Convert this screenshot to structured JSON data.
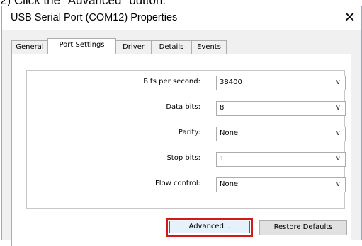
{
  "caption": "2) Click the \"Advanced\" button.",
  "window": {
    "title": "USB Serial Port (COM12) Properties",
    "close_glyph": "✕"
  },
  "tabs": [
    "General",
    "Port Settings",
    "Driver",
    "Details",
    "Events"
  ],
  "active_tab": "Port Settings",
  "fields": [
    {
      "label": "Bits per second:",
      "value": "38400"
    },
    {
      "label": "Data bits:",
      "value": "8"
    },
    {
      "label": "Parity:",
      "value": "None"
    },
    {
      "label": "Stop bits:",
      "value": "1"
    },
    {
      "label": "Flow control:",
      "value": "None"
    }
  ],
  "buttons": {
    "advanced": "Advanced...",
    "restore": "Restore Defaults"
  },
  "colors": {
    "highlight": "#d11a1a",
    "focus_border": "#0078d7"
  },
  "icons": {
    "dropdown": "chevron-down-icon",
    "close": "close-icon"
  }
}
